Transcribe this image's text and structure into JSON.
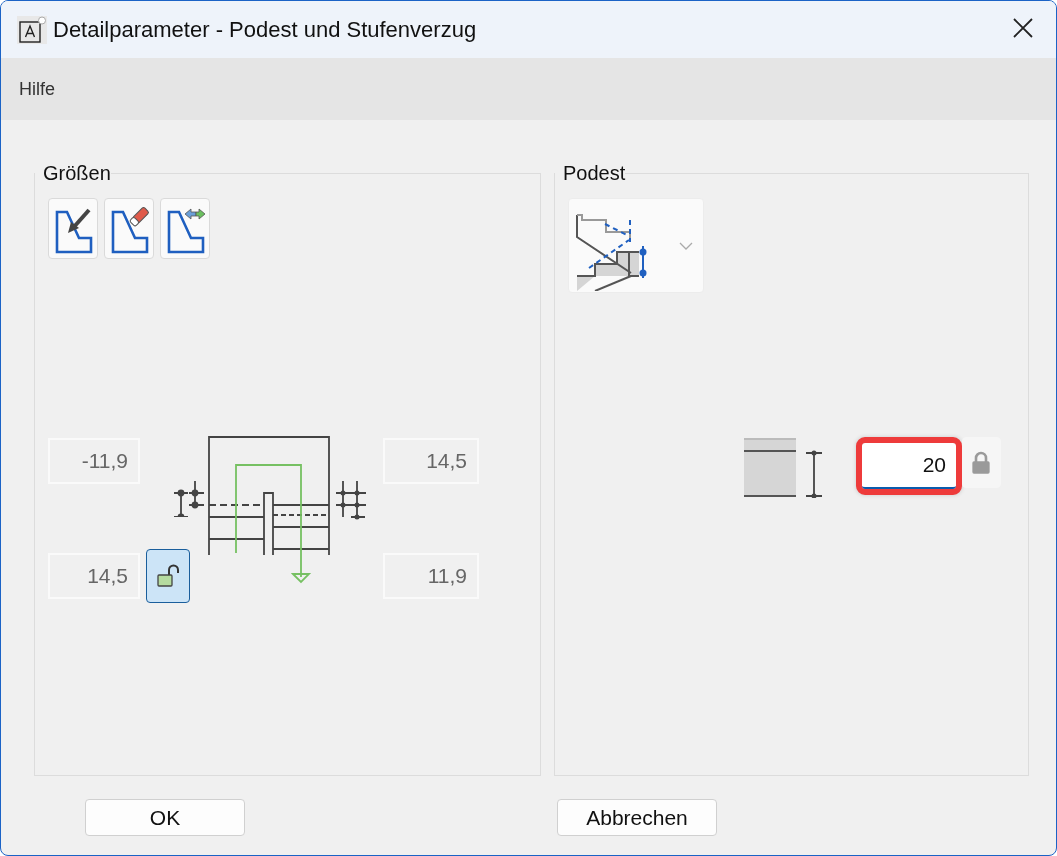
{
  "window": {
    "title": "Detailparameter - Podest und Stufenverzug"
  },
  "menu": [
    {
      "label": "Hilfe"
    }
  ],
  "sizes": {
    "title": "Größen",
    "fields": [
      {
        "value": "-11,9",
        "disabled": true
      },
      {
        "value": "14,5",
        "disabled": true
      },
      {
        "value": "14,5",
        "disabled": true
      },
      {
        "value": "11,9",
        "disabled": true
      }
    ],
    "lock": {
      "locked": false,
      "pressed": true
    }
  },
  "landing": {
    "title": "Podest",
    "field": {
      "value": "20",
      "disabled": false,
      "highlighted": true
    },
    "lock": {
      "locked": true,
      "pressed": false
    }
  },
  "buttons": [
    {
      "label": "OK"
    },
    {
      "label": "Abbrechen"
    }
  ]
}
